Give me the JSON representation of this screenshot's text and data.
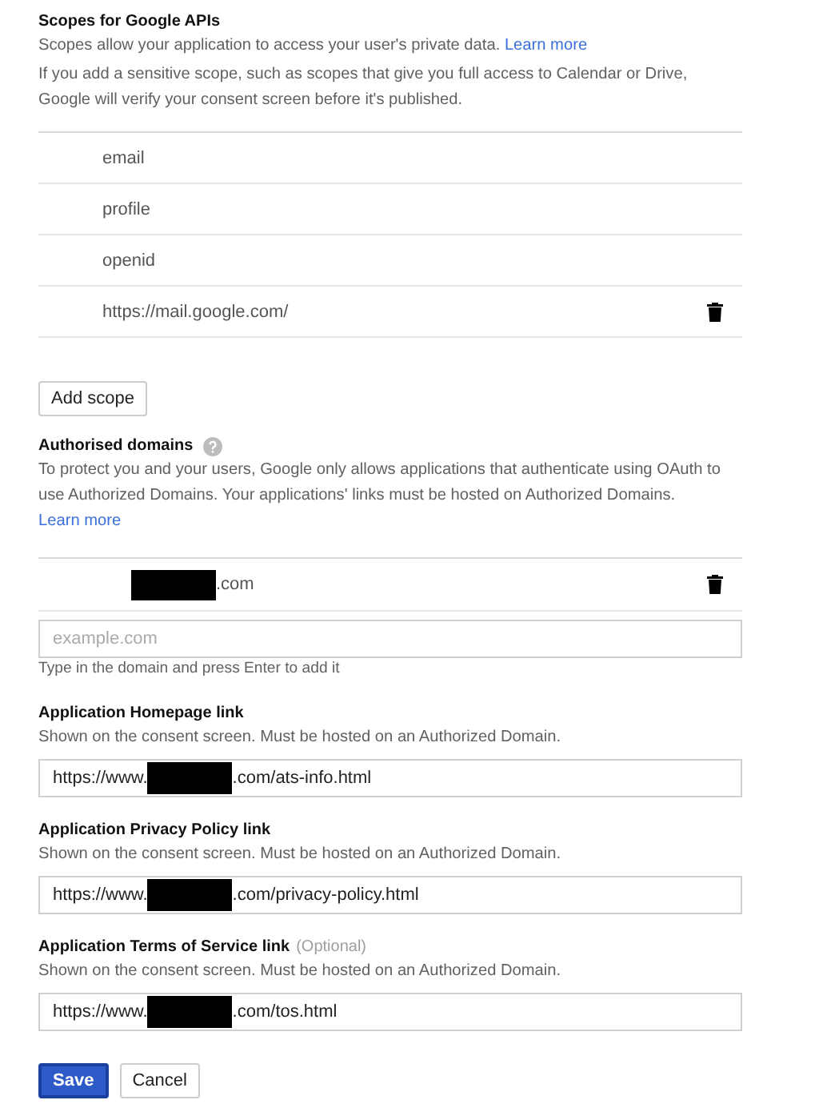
{
  "scopes_section": {
    "title": "Scopes for Google APIs",
    "description": "Scopes allow your application to access your user's private data.",
    "learn_more": "Learn more",
    "note": "If you add a sensitive scope, such as scopes that give you full access to Calendar or Drive, Google will verify your consent screen before it's published.",
    "scopes": [
      {
        "name": "email",
        "deletable": false
      },
      {
        "name": "profile",
        "deletable": false
      },
      {
        "name": "openid",
        "deletable": false
      },
      {
        "name": "https://mail.google.com/",
        "deletable": true
      }
    ],
    "add_button": "Add scope"
  },
  "domains_section": {
    "title": "Authorised domains",
    "description": "To protect you and your users, Google only allows applications that authenticate using OAuth to use Authorized Domains. Your applications' links must be hosted on Authorized Domains.",
    "learn_more": "Learn more",
    "domains": [
      {
        "redacted": true,
        "suffix": ".com",
        "deletable": true
      }
    ],
    "input": {
      "placeholder": "example.com"
    },
    "hint": "Type in the domain and press Enter to add it"
  },
  "links": [
    {
      "label": "Application Homepage link",
      "help": "Shown on the consent screen. Must be hosted on an Authorized Domain.",
      "value_prefix": "https://www.",
      "redacted": true,
      "value_suffix": ".com/ats-info.html"
    },
    {
      "label": "Application Privacy Policy link",
      "help": "Shown on the consent screen. Must be hosted on an Authorized Domain.",
      "value_prefix": "https://www.",
      "redacted": true,
      "value_suffix": ".com/privacy-policy.html"
    },
    {
      "label": "Application Terms of Service link",
      "optional": "(Optional)",
      "help": "Shown on the consent screen. Must be hosted on an Authorized Domain.",
      "value_prefix": "https://www.",
      "redacted": true,
      "value_suffix": ".com/tos.html"
    }
  ],
  "buttons": [
    {
      "label": "Save",
      "kind": "primary"
    },
    {
      "label": "Cancel",
      "kind": "secondary"
    }
  ]
}
